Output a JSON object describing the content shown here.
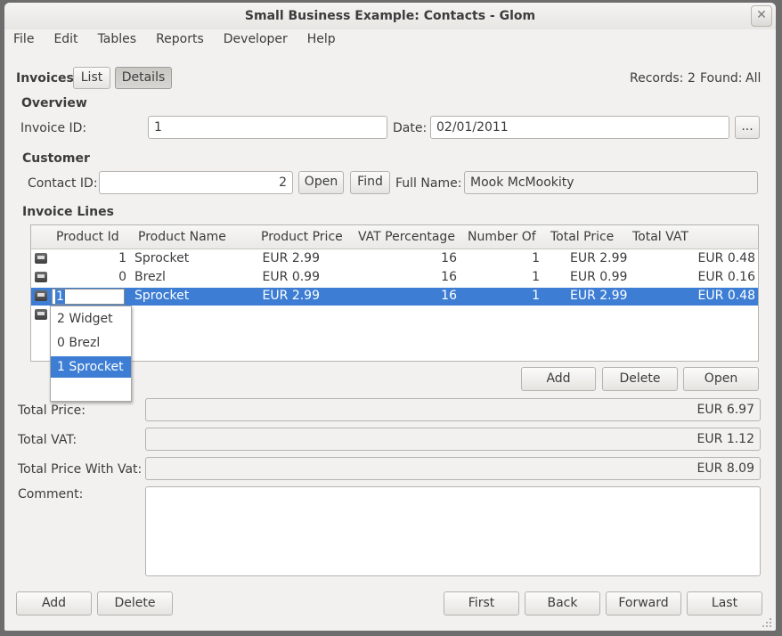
{
  "window": {
    "title": "Small Business Example: Contacts - Glom",
    "close_glyph": "✕"
  },
  "menu": [
    "File",
    "Edit",
    "Tables",
    "Reports",
    "Developer",
    "Help"
  ],
  "header": {
    "table_name": "Invoices",
    "tabs": [
      "List",
      "Details"
    ],
    "records_label": "Records:",
    "records_count": "2",
    "found_label": "Found:",
    "found_value": "All"
  },
  "overview": {
    "heading": "Overview",
    "invoice_id_label": "Invoice ID:",
    "invoice_id": "1",
    "date_label": "Date:",
    "date": "02/01/2011",
    "date_button": "..."
  },
  "customer": {
    "heading": "Customer",
    "contact_id_label": "Contact ID:",
    "contact_id": "2",
    "open_label": "Open",
    "find_label": "Find",
    "full_name_label": "Full Name:",
    "full_name": "Mook McMookity"
  },
  "invoice_lines": {
    "heading": "Invoice Lines",
    "columns": [
      "Product Id",
      "Product Name",
      "Product Price",
      "VAT Percentage",
      "Number Of",
      "Total Price",
      "Total VAT"
    ],
    "rows": [
      {
        "product_id": "1",
        "product_name": "Sprocket",
        "product_price": "EUR 2.99",
        "vat_percentage": "16",
        "number_of": "1",
        "total_price": "EUR 2.99",
        "total_vat": "EUR 0.48"
      },
      {
        "product_id": "0",
        "product_name": "Brezl",
        "product_price": "EUR 0.99",
        "vat_percentage": "16",
        "number_of": "1",
        "total_price": "EUR 0.99",
        "total_vat": "EUR 0.16"
      },
      {
        "product_id": "1",
        "product_name": "Sprocket",
        "product_price": "EUR 2.99",
        "vat_percentage": "16",
        "number_of": "1",
        "total_price": "EUR 2.99",
        "total_vat": "EUR 0.48"
      }
    ],
    "dropdown_options": [
      "2 Widget",
      "0 Brezl",
      "1 Sprocket"
    ],
    "dropdown_selected": "1 Sprocket",
    "add_label": "Add",
    "delete_label": "Delete",
    "open_label": "Open"
  },
  "totals": {
    "total_price_label": "Total Price:",
    "total_price": "EUR 6.97",
    "total_vat_label": "Total VAT:",
    "total_vat": "EUR 1.12",
    "total_with_vat_label": "Total Price With Vat:",
    "total_with_vat": "EUR 8.09",
    "comment_label": "Comment:",
    "comment": ""
  },
  "footer": {
    "add_label": "Add",
    "delete_label": "Delete",
    "first_label": "First",
    "back_label": "Back",
    "forward_label": "Forward",
    "last_label": "Last"
  },
  "colors": {
    "selection": "#3d7ed4",
    "window_bg": "#f2f1f0",
    "frame": "#6d6d6d"
  }
}
